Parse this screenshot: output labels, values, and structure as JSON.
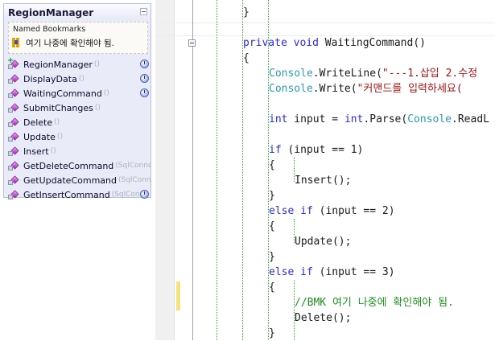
{
  "region_manager": {
    "title": "RegionManager",
    "bookmarks_title": "Named Bookmarks",
    "bookmark_text": "여기 나중에 확인해야 됨.",
    "members": [
      {
        "name": "RegionManager",
        "sig": "()",
        "plus": true,
        "badge": true
      },
      {
        "name": "DisplayData",
        "sig": "()",
        "plus": false,
        "badge": true
      },
      {
        "name": "WaitingCommand",
        "sig": "()",
        "plus": false,
        "badge": true
      },
      {
        "name": "SubmitChanges",
        "sig": "()",
        "plus": false,
        "badge": false
      },
      {
        "name": "Delete",
        "sig": "()",
        "plus": false,
        "badge": false
      },
      {
        "name": "Update",
        "sig": "()",
        "plus": false,
        "badge": false
      },
      {
        "name": "Insert",
        "sig": "()",
        "plus": false,
        "badge": false
      },
      {
        "name": "GetDeleteCommand",
        "sig": "(SqlConnectio",
        "plus": false,
        "badge": false
      },
      {
        "name": "GetUpdateCommand",
        "sig": "(SqlConnect",
        "plus": false,
        "badge": false
      },
      {
        "name": "GetInsertCommand",
        "sig": "(SqlConne",
        "plus": false,
        "badge": true
      }
    ]
  },
  "code": {
    "l0": "}",
    "l1_kw1": "private",
    "l1_kw2": "void",
    "l1_rest": " WaitingCommand()",
    "l2": "{",
    "l3_ty": "Console",
    "l3_a": ".WriteLine(",
    "l3_str": "\"---1.삽입 2.수정",
    "l4_ty": "Console",
    "l4_a": ".Write(",
    "l4_str": "\"커맨드를 입력하세요(",
    "l5_kw": "int",
    "l5_a": " input = ",
    "l5_kw2": "int",
    "l5_b": ".Parse(",
    "l5_ty": "Console",
    "l5_c": ".ReadL",
    "l6_kw": "if",
    "l6_a": " (input == 1)",
    "l7": "{",
    "l8": "Insert();",
    "l9": "}",
    "l10_kw1": "else",
    "l10_kw2": "if",
    "l10_a": " (input == 2)",
    "l11": "{",
    "l12": "Update();",
    "l13": "}",
    "l14_kw1": "else",
    "l14_kw2": "if",
    "l14_a": " (input == 3)",
    "l15": "{",
    "l16_cm": "//BMK 여기 나중에 확인해야 됨.",
    "l17": "Delete();",
    "l18": "}"
  },
  "colors": {
    "keyword": "#2b2bd6",
    "type": "#2b9ab0",
    "string": "#a31515",
    "comment": "#1f8d1f"
  }
}
